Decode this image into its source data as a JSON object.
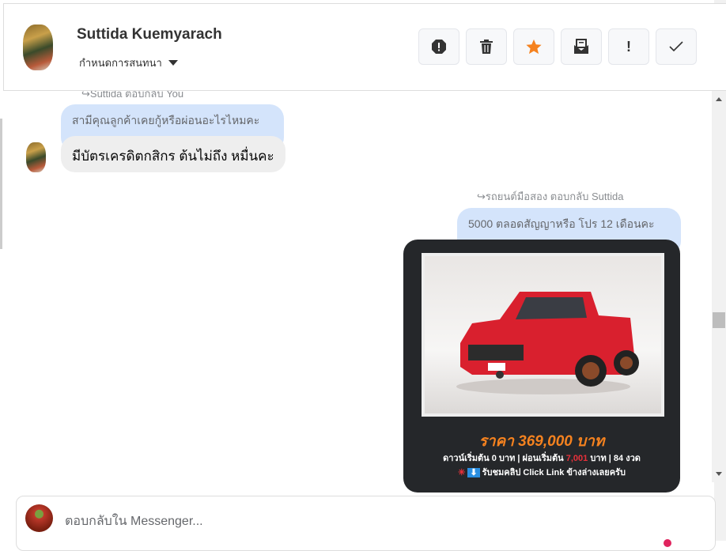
{
  "header": {
    "contact_name": "Suttida Kuemyarach",
    "assign_label": "กำหนดการสนทนา"
  },
  "toolbar": [
    {
      "name": "spam-button",
      "icon": "octagon-alert-icon"
    },
    {
      "name": "delete-button",
      "icon": "trash-icon"
    },
    {
      "name": "star-button",
      "icon": "star-icon",
      "color": "#f5821f"
    },
    {
      "name": "mark-unread-button",
      "icon": "envelope-open-icon"
    },
    {
      "name": "important-button",
      "icon": "exclamation-icon"
    },
    {
      "name": "done-button",
      "icon": "check-icon"
    }
  ],
  "messages": {
    "m1_meta": "Suttida ตอบกลับ You",
    "m1_quoted": "สามีคุณลูกค้าเคยกู้หรือผ่อนอะไรไหมคะ",
    "m1_text": "มีบัตรเครดิตกสิกร ต้นไม่ถึง หมื่นคะ",
    "m2_meta": "รถยนต์มือสอง ตอบกลับ Suttida",
    "m2_quoted": "5000 ตลอดสัญญาหรือ โปร 12 เดือนคะ",
    "card": {
      "price": "ราคา 369,000 บาท",
      "line1_a": "ดาวน์เริ่มต้น 0 บาท | ผ่อนเริ่มต้น ",
      "line1_b": "7,001",
      "line1_c": " บาท | 84 งวด",
      "line2": "รับชมคลิป Click Link ข้างล่างเลยครับ"
    }
  },
  "composer": {
    "placeholder": "ตอบกลับใน Messenger..."
  },
  "colors": {
    "accent_orange": "#f5821f",
    "bubble_blue": "#d4e4fb",
    "bubble_gray": "#eeeeee"
  }
}
